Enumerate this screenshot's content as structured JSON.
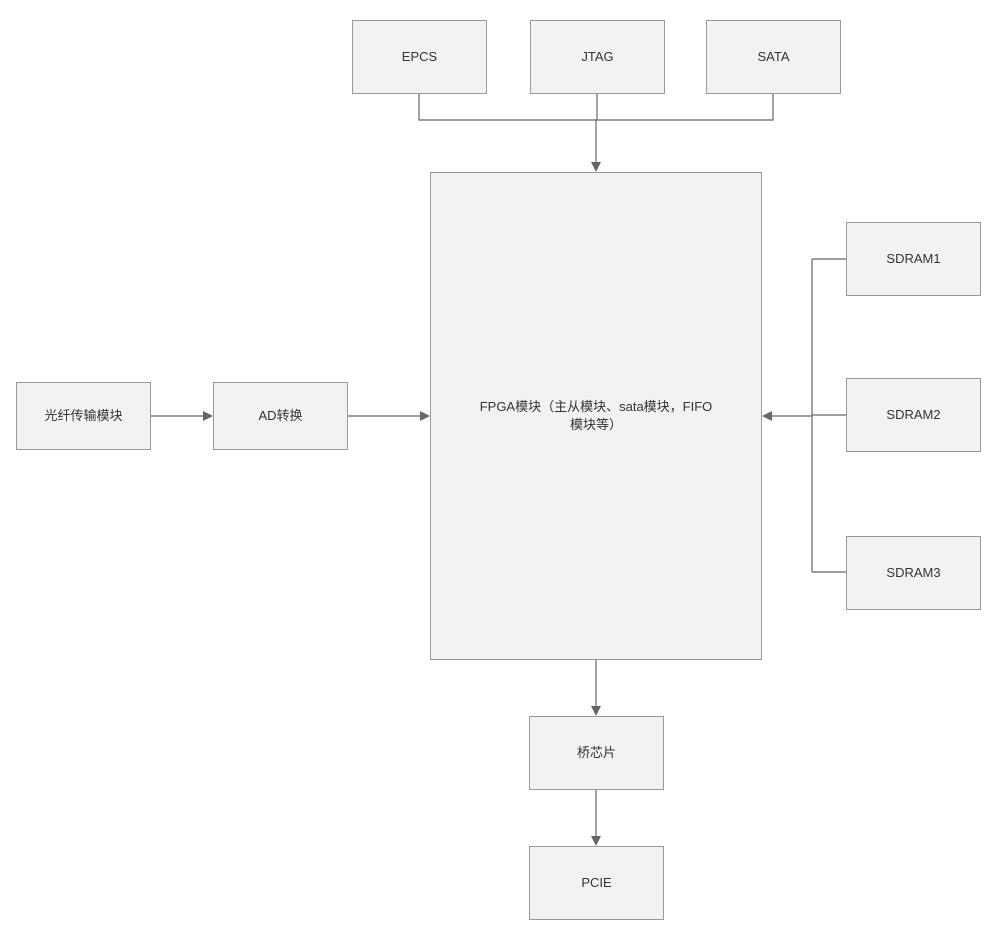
{
  "blocks": {
    "epcs": "EPCS",
    "jtag": "JTAG",
    "sata": "SATA",
    "fiber": "光纤传输模块",
    "ad": "AD转换",
    "fpga": "FPGA模块（主从模块、sata模块，FIFO模块等）",
    "sdram1": "SDRAM1",
    "sdram2": "SDRAM2",
    "sdram3": "SDRAM3",
    "bridge": "桥芯片",
    "pcie": "PCIE"
  }
}
